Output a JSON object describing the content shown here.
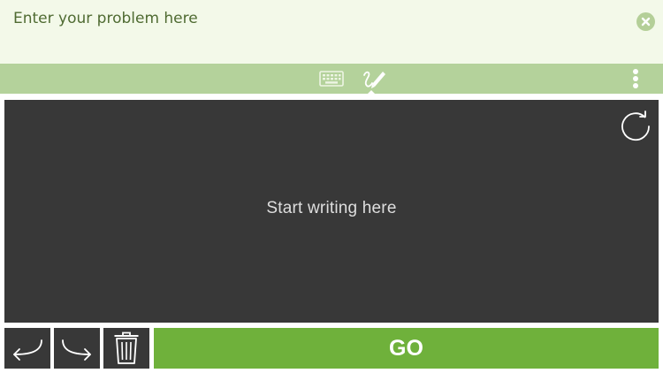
{
  "problem": {
    "value": "",
    "placeholder": "Enter your problem here"
  },
  "toolbar": {
    "modes": [
      {
        "icon": "keyboard-icon",
        "active": false
      },
      {
        "icon": "handwriting-pen-icon",
        "active": true
      }
    ],
    "menu_icon": "more-vertical-icon"
  },
  "canvas": {
    "hint": "Start writing here"
  },
  "controls": {
    "undo_icon": "undo-arrow-icon",
    "redo_icon": "redo-arrow-icon",
    "delete_icon": "trash-icon",
    "go_label": "GO"
  },
  "colors": {
    "input_bg": "#f3f9e9",
    "toolbar_bg": "#b4d29b",
    "canvas_bg": "#383838",
    "go_button": "#6fb13b"
  }
}
